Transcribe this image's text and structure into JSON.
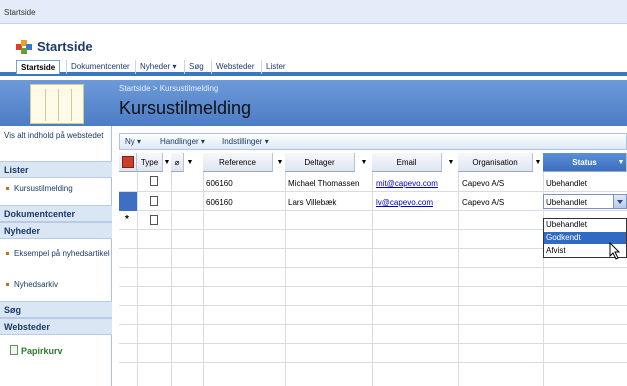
{
  "topbar": {
    "label": "Startside"
  },
  "site": {
    "title": "Startside"
  },
  "tabs": [
    "Startside",
    "Dokumentcenter",
    "Nyheder ▾",
    "Søg",
    "Websteder",
    "Lister"
  ],
  "breadcrumb": "Startside > Kursustilmelding",
  "page_title": "Kursustilmelding",
  "leftnav": {
    "view_all": "Vis alt indhold på webstedet",
    "sections": {
      "lister": "Lister",
      "dokumentcenter": "Dokumentcenter",
      "nyheder": "Nyheder",
      "sog": "Søg",
      "websteder": "Websteder"
    },
    "items": {
      "kursus": "Kursustilmelding",
      "eksempel": "Eksempel på nyhedsartikel",
      "arkiv": "Nyhedsarkiv"
    },
    "recycle": "Papirkurv"
  },
  "toolbar": {
    "new": "Ny ▾",
    "actions": "Handlinger ▾",
    "settings": "Indstillinger ▾"
  },
  "grid": {
    "headers": [
      "Type",
      "Reference",
      "Deltager",
      "Email",
      "Organisation",
      "Status"
    ],
    "rows": [
      {
        "reference": "606160",
        "deltager": "Michael Thomassen",
        "email": "mit@capevo.com",
        "organisation": "Capevo A/S",
        "status": "Ubehandlet"
      },
      {
        "reference": "606160",
        "deltager": "Lars Villebæk",
        "email": "lv@capevo.com",
        "organisation": "Capevo A/S",
        "status": "Ubehandlet"
      }
    ],
    "new_row_marker": "*"
  },
  "status_options": [
    "Ubehandlet",
    "Godkendt",
    "Afvist"
  ],
  "status_selected_option": "Godkendt",
  "colors": {
    "accent": "#3a77c3",
    "title_band": "#5a8ad0",
    "selection": "#316ac5",
    "status_header": "#3a6fc0"
  }
}
